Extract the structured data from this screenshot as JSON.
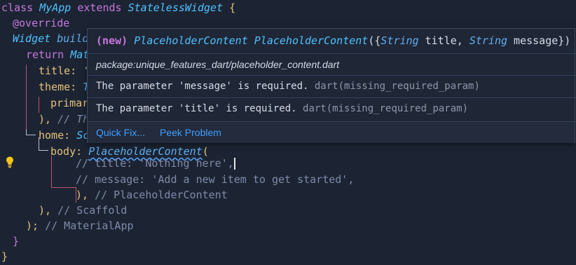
{
  "code": {
    "l1": {
      "kw": "class",
      "name": "MyApp",
      "ext": "extends",
      "base": "StatelessWidget",
      "brace": "{"
    },
    "l2": {
      "text": "@override"
    },
    "l3": {
      "type": "Widget",
      "name": "build"
    },
    "l4": {
      "kw": "return",
      "name": "Mat"
    },
    "l5": {
      "prop": "title:",
      "rest": "'"
    },
    "l6": {
      "prop": "theme:",
      "rest": "T"
    },
    "l7": {
      "prop": "primar"
    },
    "l8": {
      "punc": "),",
      "cmt": "// Th"
    },
    "l9": {
      "prop": "home:",
      "rest": "Sc"
    },
    "l10": {
      "prop": "body:",
      "fn": "PlaceholderContent",
      "paren": "("
    },
    "l11": {
      "cmt": "// title: 'Nothing here',"
    },
    "l12": {
      "cmt": "// message: 'Add a new item to get started',"
    },
    "l13": {
      "punc": "),",
      "cmt": "// PlaceholderContent"
    },
    "l14": {
      "punc": "),",
      "cmt": "// Scaffold"
    },
    "l15": {
      "punc": ");",
      "cmt": "// MaterialApp"
    },
    "l16": {
      "punc": "}"
    },
    "l17": {
      "punc": "}"
    }
  },
  "hover": {
    "signature": {
      "new": "(new)",
      "class1": "PlaceholderContent",
      "class2": "PlaceholderContent",
      "params_open": "({",
      "t1": "String",
      "p1": " title, ",
      "t2": "String",
      "p2": " message})"
    },
    "package": "package:unique_features_dart/placeholder_content.dart",
    "errors": [
      {
        "message": "The parameter 'message' is required.",
        "code": "dart(missing_required_param)"
      },
      {
        "message": "The parameter 'title' is required.",
        "code": "dart(missing_required_param)"
      }
    ],
    "actions": {
      "quick_fix": "Quick Fix...",
      "peek_problem": "Peek Problem"
    }
  },
  "colors": {
    "accent": "#3fa0ff",
    "background": "#1c2433",
    "keyword": "#c678dd",
    "type": "#4fc1ff"
  },
  "icons": {
    "lightbulb": "lightbulb-icon"
  }
}
